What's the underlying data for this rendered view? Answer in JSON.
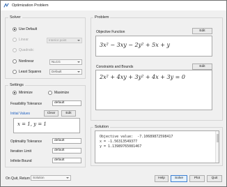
{
  "window": {
    "title": "Optimization Problem"
  },
  "solver": {
    "group_label": "Solver",
    "options": [
      {
        "label": "Use Default",
        "selected": true,
        "enabled": true
      },
      {
        "label": "Linear",
        "selected": false,
        "enabled": false
      },
      {
        "label": "Quadratic",
        "selected": false,
        "enabled": false
      },
      {
        "label": "Nonlinear",
        "selected": false,
        "enabled": true
      },
      {
        "label": "Least Squares",
        "selected": false,
        "enabled": true
      }
    ],
    "linear_method": "Interior point",
    "nonlinear_method": "NLCG",
    "leastsq_method": "Default"
  },
  "settings": {
    "group_label": "Settings",
    "minimize_label": "Minimize",
    "maximize_label": "Maximize",
    "objective_sense": "Minimize",
    "feasibility_label": "Feasibility Tolerance",
    "feasibility_value": "default",
    "initial_values_label": "Initial Values",
    "clear_label": "Clear",
    "edit_label": "Edit",
    "initial_values_expr": "x = 1,  y = 1",
    "optimality_label": "Optimality Tolerance",
    "optimality_value": "default",
    "iteration_label": "Iteration Limit",
    "iteration_value": "default",
    "infinite_label": "Infinite Bound",
    "infinite_value": "default"
  },
  "problem": {
    "group_label": "Problem",
    "objective_label": "Objective Function",
    "objective_edit": "Edit",
    "objective_expr": "3x² − 3xy − 2y² + 5x + y",
    "constraints_label": "Constraints and Bounds",
    "constraints_edit": "Edit",
    "constraints_expr": "2x² + 4xy + 3y² + 4x + 3y = 0"
  },
  "solution": {
    "group_label": "Solution",
    "lines": [
      "Objective value:  -7.10689872598417",
      "x = -1.56313549377",
      "y = 1.13989765081467"
    ]
  },
  "footer": {
    "on_quit_label": "On Quit, Return",
    "on_quit_value": "Solution",
    "help_label": "Help",
    "solve_label": "Solve",
    "plot_label": "Plot",
    "quit_label": "Quit"
  }
}
